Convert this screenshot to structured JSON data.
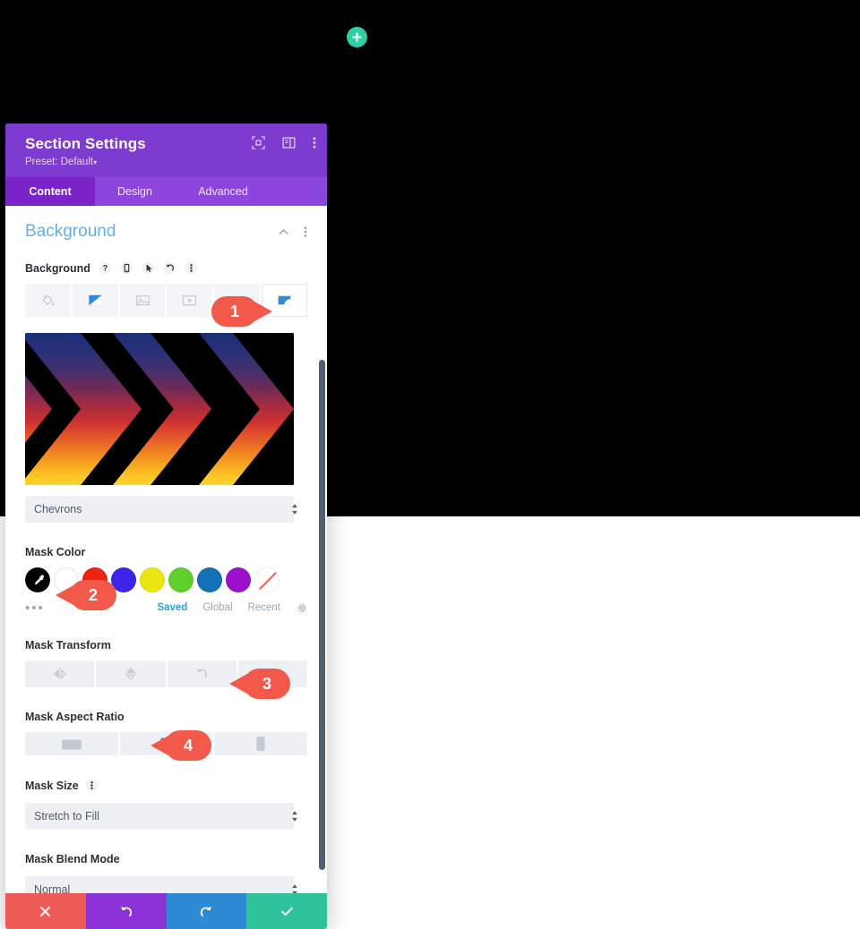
{
  "canvas": {
    "add_button_icon": "plus-icon",
    "background_description": "Black chevron mask over blue-to-yellow gradient"
  },
  "panel": {
    "title": "Section Settings",
    "preset_label": "Preset: Default",
    "preset_caret": "▾",
    "header_icons": [
      {
        "name": "expand-icon"
      },
      {
        "name": "layout-toggle-icon"
      },
      {
        "name": "more-options-icon"
      }
    ],
    "tabs": [
      {
        "label": "Content",
        "active": true
      },
      {
        "label": "Design",
        "active": false
      },
      {
        "label": "Advanced",
        "active": false
      }
    ],
    "section": {
      "title": "Background",
      "collapse_icon": "chevron-up-icon",
      "more_icon": "more-options-icon"
    },
    "background_field": {
      "label": "Background",
      "icons": [
        "help-icon",
        "device-icon",
        "cursor-icon",
        "reset-icon",
        "more-options-icon"
      ],
      "types": [
        {
          "name": "bg-color",
          "icon": "paint-bucket-icon",
          "selected": false
        },
        {
          "name": "bg-gradient",
          "icon": "gradient-icon",
          "selected": false
        },
        {
          "name": "bg-image",
          "icon": "image-icon",
          "selected": false
        },
        {
          "name": "bg-video",
          "icon": "video-icon",
          "selected": false
        },
        {
          "name": "bg-pattern",
          "icon": "pattern-icon",
          "selected": false
        },
        {
          "name": "bg-mask",
          "icon": "mask-icon",
          "selected": true
        }
      ]
    },
    "mask_pattern": {
      "label": "",
      "value": "Chevrons",
      "options": [
        "Chevrons"
      ]
    },
    "mask_color": {
      "label": "Mask Color",
      "swatches": [
        {
          "name": "custom-color",
          "hex": "#000000",
          "selected": true,
          "icon": "eyedropper-icon"
        },
        {
          "name": "white",
          "hex": "#ffffff",
          "selected": false
        },
        {
          "name": "red",
          "hex": "#f02311",
          "selected": false
        },
        {
          "name": "blue-violet",
          "hex": "#3b25e8",
          "selected": false
        },
        {
          "name": "yellow",
          "hex": "#ebe511",
          "selected": false
        },
        {
          "name": "green",
          "hex": "#5fcf2c",
          "selected": false
        },
        {
          "name": "blue",
          "hex": "#1471b7",
          "selected": false
        },
        {
          "name": "purple",
          "hex": "#9d0fcd",
          "selected": false
        },
        {
          "name": "transparent",
          "hex": "none",
          "selected": false
        }
      ],
      "more_dots": "•••",
      "links": [
        {
          "label": "Saved",
          "active": true
        },
        {
          "label": "Global",
          "active": false
        },
        {
          "label": "Recent",
          "active": false
        }
      ],
      "settings_icon": "gear-icon"
    },
    "mask_transform": {
      "label": "Mask Transform",
      "buttons": [
        {
          "name": "flip-horizontal",
          "icon": "flip-horizontal-icon",
          "active": false
        },
        {
          "name": "flip-vertical",
          "icon": "flip-vertical-icon",
          "active": false
        },
        {
          "name": "rotate",
          "icon": "rotate-icon",
          "active": false
        },
        {
          "name": "invert",
          "icon": "invert-icon",
          "active": true
        }
      ]
    },
    "mask_aspect_ratio": {
      "label": "Mask Aspect Ratio",
      "buttons": [
        {
          "name": "aspect-landscape",
          "icon": "landscape-icon",
          "active": false
        },
        {
          "name": "aspect-square",
          "icon": "square-icon",
          "active": true
        },
        {
          "name": "aspect-portrait",
          "icon": "portrait-icon",
          "active": false
        }
      ]
    },
    "mask_size": {
      "label": "Mask Size",
      "more_icon": "more-options-icon",
      "value": "Stretch to Fill",
      "options": [
        "Stretch to Fill"
      ]
    },
    "mask_blend_mode": {
      "label": "Mask Blend Mode",
      "value": "Normal",
      "options": [
        "Normal"
      ]
    },
    "actions": [
      {
        "name": "cancel-button",
        "icon": "close-icon",
        "color": "#ee5b56"
      },
      {
        "name": "undo-button",
        "icon": "undo-icon",
        "color": "#8b33d6"
      },
      {
        "name": "redo-button",
        "icon": "redo-icon",
        "color": "#2d8bd4"
      },
      {
        "name": "save-button",
        "icon": "check-icon",
        "color": "#2ec39a"
      }
    ]
  },
  "callouts": [
    {
      "number": "1",
      "target": "bg-mask-type-button"
    },
    {
      "number": "2",
      "target": "mask-color-custom-swatch"
    },
    {
      "number": "3",
      "target": "mask-transform-invert-button"
    },
    {
      "number": "4",
      "target": "mask-aspect-ratio-square-button"
    }
  ],
  "colors": {
    "header_purple": "#7e3bd0",
    "tabs_purple": "#8c45dd",
    "tab_active_purple": "#7a23c9",
    "section_title_blue": "#66afe0",
    "accent_blue": "#2d9ce0",
    "callout_red": "#f2594b",
    "add_green": "#2ecfa5"
  }
}
